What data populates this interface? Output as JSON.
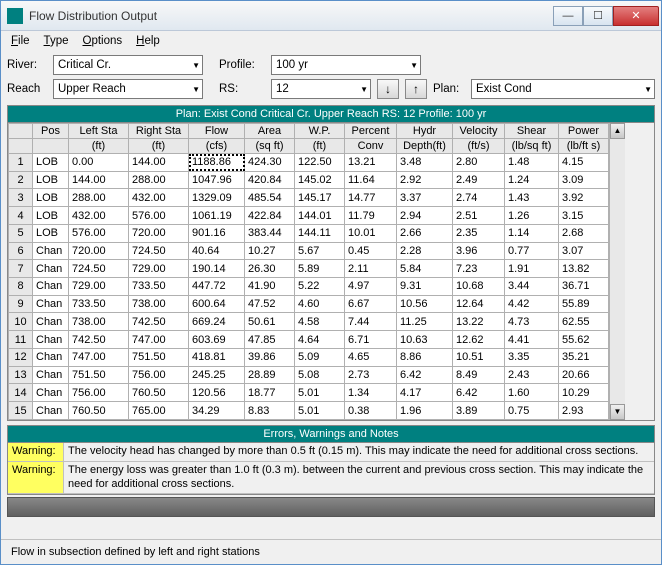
{
  "window": {
    "title": "Flow Distribution Output"
  },
  "menu": {
    "file": "File",
    "type": "Type",
    "options": "Options",
    "help": "Help"
  },
  "labels": {
    "river": "River:",
    "profile": "Profile:",
    "reach": "Reach",
    "rs": "RS:",
    "plan": "Plan:"
  },
  "selects": {
    "river": "Critical Cr.",
    "profile": "100 yr",
    "reach": "Upper Reach",
    "rs": "12",
    "plan": "Exist Cond"
  },
  "planbar": "Plan: Exist Cond    Critical Cr.    Upper Reach  RS: 12    Profile: 100 yr",
  "headers": [
    "Pos",
    "Left Sta",
    "Right Sta",
    "Flow",
    "Area",
    "W.P.",
    "Percent",
    "Hydr",
    "Velocity",
    "Shear",
    "Power"
  ],
  "units": [
    "",
    "(ft)",
    "(ft)",
    "(cfs)",
    "(sq ft)",
    "(ft)",
    "Conv",
    "Depth(ft)",
    "(ft/s)",
    "(lb/sq ft)",
    "(lb/ft s)"
  ],
  "rows": [
    {
      "n": "1",
      "pos": "LOB",
      "l": "0.00",
      "r": "144.00",
      "f": "1188.86",
      "a": "424.30",
      "w": "122.50",
      "p": "13.21",
      "h": "3.48",
      "v": "2.80",
      "s": "1.48",
      "pw": "4.15"
    },
    {
      "n": "2",
      "pos": "LOB",
      "l": "144.00",
      "r": "288.00",
      "f": "1047.96",
      "a": "420.84",
      "w": "145.02",
      "p": "11.64",
      "h": "2.92",
      "v": "2.49",
      "s": "1.24",
      "pw": "3.09"
    },
    {
      "n": "3",
      "pos": "LOB",
      "l": "288.00",
      "r": "432.00",
      "f": "1329.09",
      "a": "485.54",
      "w": "145.17",
      "p": "14.77",
      "h": "3.37",
      "v": "2.74",
      "s": "1.43",
      "pw": "3.92"
    },
    {
      "n": "4",
      "pos": "LOB",
      "l": "432.00",
      "r": "576.00",
      "f": "1061.19",
      "a": "422.84",
      "w": "144.01",
      "p": "11.79",
      "h": "2.94",
      "v": "2.51",
      "s": "1.26",
      "pw": "3.15"
    },
    {
      "n": "5",
      "pos": "LOB",
      "l": "576.00",
      "r": "720.00",
      "f": "901.16",
      "a": "383.44",
      "w": "144.11",
      "p": "10.01",
      "h": "2.66",
      "v": "2.35",
      "s": "1.14",
      "pw": "2.68"
    },
    {
      "n": "6",
      "pos": "Chan",
      "l": "720.00",
      "r": "724.50",
      "f": "40.64",
      "a": "10.27",
      "w": "5.67",
      "p": "0.45",
      "h": "2.28",
      "v": "3.96",
      "s": "0.77",
      "pw": "3.07"
    },
    {
      "n": "7",
      "pos": "Chan",
      "l": "724.50",
      "r": "729.00",
      "f": "190.14",
      "a": "26.30",
      "w": "5.89",
      "p": "2.11",
      "h": "5.84",
      "v": "7.23",
      "s": "1.91",
      "pw": "13.82"
    },
    {
      "n": "8",
      "pos": "Chan",
      "l": "729.00",
      "r": "733.50",
      "f": "447.72",
      "a": "41.90",
      "w": "5.22",
      "p": "4.97",
      "h": "9.31",
      "v": "10.68",
      "s": "3.44",
      "pw": "36.71"
    },
    {
      "n": "9",
      "pos": "Chan",
      "l": "733.50",
      "r": "738.00",
      "f": "600.64",
      "a": "47.52",
      "w": "4.60",
      "p": "6.67",
      "h": "10.56",
      "v": "12.64",
      "s": "4.42",
      "pw": "55.89"
    },
    {
      "n": "10",
      "pos": "Chan",
      "l": "738.00",
      "r": "742.50",
      "f": "669.24",
      "a": "50.61",
      "w": "4.58",
      "p": "7.44",
      "h": "11.25",
      "v": "13.22",
      "s": "4.73",
      "pw": "62.55"
    },
    {
      "n": "11",
      "pos": "Chan",
      "l": "742.50",
      "r": "747.00",
      "f": "603.69",
      "a": "47.85",
      "w": "4.64",
      "p": "6.71",
      "h": "10.63",
      "v": "12.62",
      "s": "4.41",
      "pw": "55.62"
    },
    {
      "n": "12",
      "pos": "Chan",
      "l": "747.00",
      "r": "751.50",
      "f": "418.81",
      "a": "39.86",
      "w": "5.09",
      "p": "4.65",
      "h": "8.86",
      "v": "10.51",
      "s": "3.35",
      "pw": "35.21"
    },
    {
      "n": "13",
      "pos": "Chan",
      "l": "751.50",
      "r": "756.00",
      "f": "245.25",
      "a": "28.89",
      "w": "5.08",
      "p": "2.73",
      "h": "6.42",
      "v": "8.49",
      "s": "2.43",
      "pw": "20.66"
    },
    {
      "n": "14",
      "pos": "Chan",
      "l": "756.00",
      "r": "760.50",
      "f": "120.56",
      "a": "18.77",
      "w": "5.01",
      "p": "1.34",
      "h": "4.17",
      "v": "6.42",
      "s": "1.60",
      "pw": "10.29"
    },
    {
      "n": "15",
      "pos": "Chan",
      "l": "760.50",
      "r": "765.00",
      "f": "34.29",
      "a": "8.83",
      "w": "5.01",
      "p": "0.38",
      "h": "1.96",
      "v": "3.89",
      "s": "0.75",
      "pw": "2.93"
    }
  ],
  "errors_title": "Errors, Warnings and Notes",
  "warnings": [
    {
      "tag": "Warning:",
      "text": "The velocity head has changed by more than 0.5 ft (0.15 m).  This may indicate the need for additional cross sections."
    },
    {
      "tag": "Warning:",
      "text": "The energy loss was greater than 1.0 ft (0.3 m). between the current and previous cross section.  This may indicate the need for additional cross sections."
    }
  ],
  "status": "Flow in subsection defined by left and right stations"
}
